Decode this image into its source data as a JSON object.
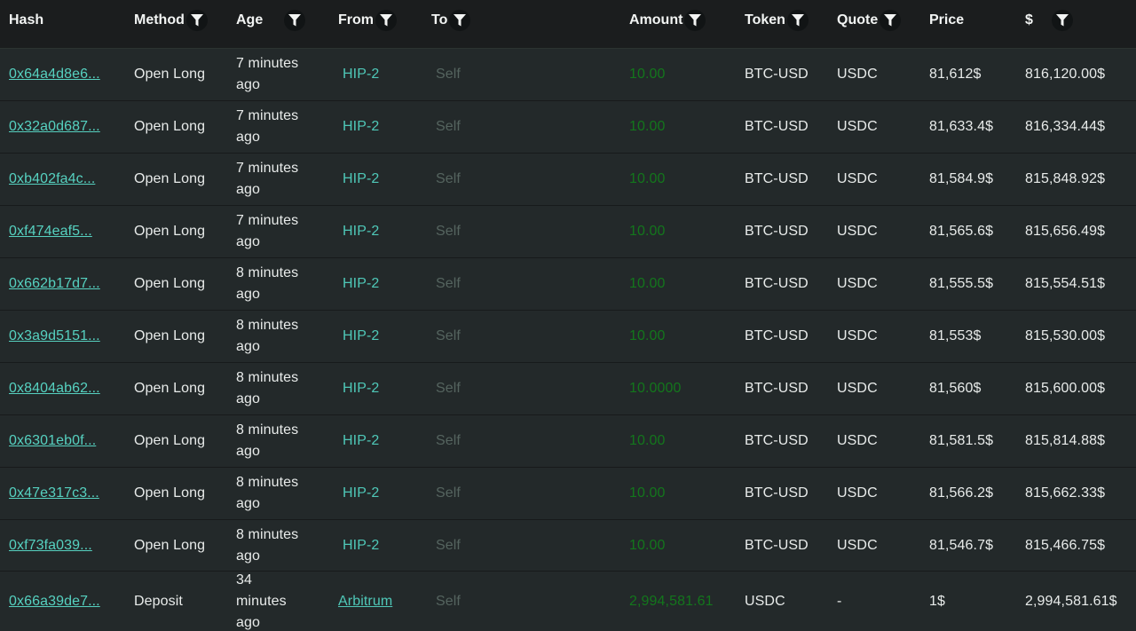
{
  "header": {
    "hash": "Hash",
    "method": "Method",
    "age": "Age",
    "from": "From",
    "to": "To",
    "amount": "Amount",
    "token": "Token",
    "quote": "Quote",
    "price": "Price",
    "usd": "$"
  },
  "rows": [
    {
      "hash": "0x64a4d8e6...",
      "method": "Open Long",
      "age": "7 minutes ago",
      "from": "HIP-2",
      "to": "Self",
      "amount": "10.00",
      "token": "BTC-USD",
      "quote": "USDC",
      "price": "81,612$",
      "usd": "816,120.00$"
    },
    {
      "hash": "0x32a0d687...",
      "method": "Open Long",
      "age": "7 minutes ago",
      "from": "HIP-2",
      "to": "Self",
      "amount": "10.00",
      "token": "BTC-USD",
      "quote": "USDC",
      "price": "81,633.4$",
      "usd": "816,334.44$"
    },
    {
      "hash": "0xb402fa4c...",
      "method": "Open Long",
      "age": "7 minutes ago",
      "from": "HIP-2",
      "to": "Self",
      "amount": "10.00",
      "token": "BTC-USD",
      "quote": "USDC",
      "price": "81,584.9$",
      "usd": "815,848.92$"
    },
    {
      "hash": "0xf474eaf5...",
      "method": "Open Long",
      "age": "7 minutes ago",
      "from": "HIP-2",
      "to": "Self",
      "amount": "10.00",
      "token": "BTC-USD",
      "quote": "USDC",
      "price": "81,565.6$",
      "usd": "815,656.49$"
    },
    {
      "hash": "0x662b17d7...",
      "method": "Open Long",
      "age": "8 minutes ago",
      "from": "HIP-2",
      "to": "Self",
      "amount": "10.00",
      "token": "BTC-USD",
      "quote": "USDC",
      "price": "81,555.5$",
      "usd": "815,554.51$"
    },
    {
      "hash": "0x3a9d5151...",
      "method": "Open Long",
      "age": "8 minutes ago",
      "from": "HIP-2",
      "to": "Self",
      "amount": "10.00",
      "token": "BTC-USD",
      "quote": "USDC",
      "price": "81,553$",
      "usd": "815,530.00$"
    },
    {
      "hash": "0x8404ab62...",
      "method": "Open Long",
      "age": "8 minutes ago",
      "from": "HIP-2",
      "to": "Self",
      "amount": "10.0000",
      "token": "BTC-USD",
      "quote": "USDC",
      "price": "81,560$",
      "usd": "815,600.00$"
    },
    {
      "hash": "0x6301eb0f...",
      "method": "Open Long",
      "age": "8 minutes ago",
      "from": "HIP-2",
      "to": "Self",
      "amount": "10.00",
      "token": "BTC-USD",
      "quote": "USDC",
      "price": "81,581.5$",
      "usd": "815,814.88$"
    },
    {
      "hash": "0x47e317c3...",
      "method": "Open Long",
      "age": "8 minutes ago",
      "from": "HIP-2",
      "to": "Self",
      "amount": "10.00",
      "token": "BTC-USD",
      "quote": "USDC",
      "price": "81,566.2$",
      "usd": "815,662.33$"
    },
    {
      "hash": "0xf73fa039...",
      "method": "Open Long",
      "age": "8 minutes ago",
      "from": "HIP-2",
      "to": "Self",
      "amount": "10.00",
      "token": "BTC-USD",
      "quote": "USDC",
      "price": "81,546.7$",
      "usd": "815,466.75$"
    },
    {
      "hash": "0x66a39de7...",
      "method": "Deposit",
      "age": "34 minutes ago",
      "from": "Arbitrum",
      "to": "Self",
      "amount": "2,994,581.61",
      "token": "USDC",
      "quote": "-",
      "price": "1$",
      "usd": "2,994,581.61$"
    }
  ],
  "icons": {
    "filter": "filter-funnel-icon"
  },
  "colors": {
    "background": "#1f2322",
    "row_background": "#23292a",
    "header_background": "#1b1d1e",
    "hash_link": "#56d1c0",
    "from_text": "#4fc8b8",
    "to_text": "#55645f",
    "amount_text": "#13761c"
  }
}
